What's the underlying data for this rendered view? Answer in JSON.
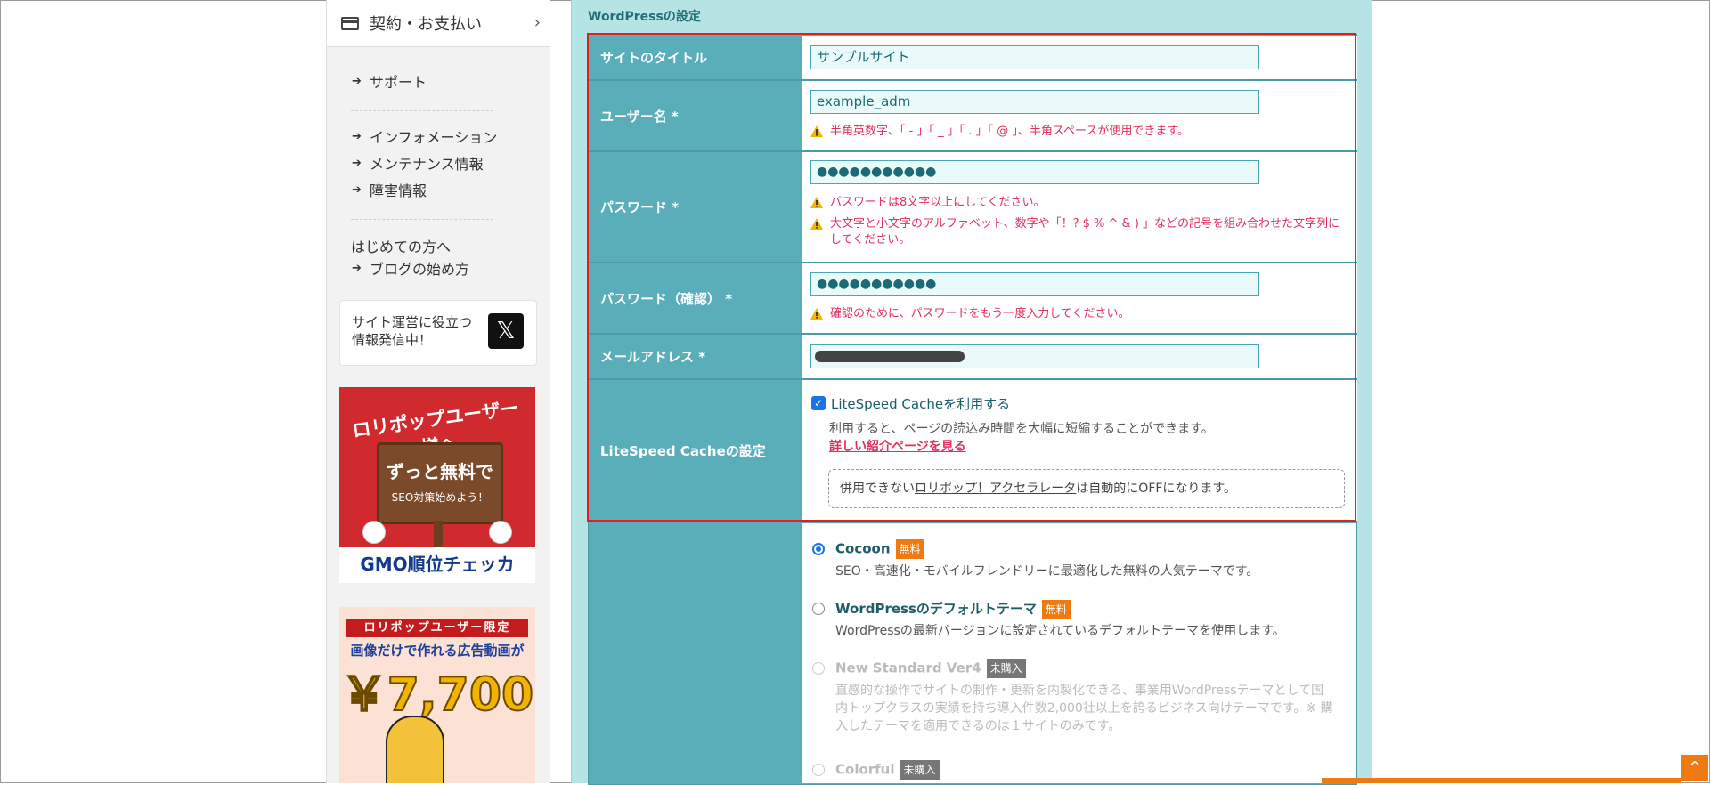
{
  "sidebar": {
    "contract": {
      "label": "契約・お支払い",
      "chevron": "›"
    },
    "support": "サポート",
    "info_links": [
      "インフォメーション",
      "メンテナンス情報",
      "障害情報"
    ],
    "beginner_heading": "はじめての方へ",
    "blog_link": "ブログの始め方",
    "x_box": {
      "line1": "サイト運営に役立つ",
      "line2": "情報発信中！",
      "logo": "𝕏"
    },
    "banner1": {
      "title": "ロリポップユーザー様へ",
      "sign_main": "ずっと無料で",
      "sign_sub": "SEO対策始めよう！",
      "brand": "GMO順位チェッカー"
    },
    "banner2": {
      "tag": "ロリポップユーザー限定",
      "line": "画像だけで作れる広告動画が",
      "price": "￥7,700"
    }
  },
  "main": {
    "section_title": "WordPressの設定",
    "site_title": {
      "label": "サイトのタイトル",
      "value": "サンプルサイト"
    },
    "username": {
      "label": "ユーザー名 *",
      "value": "example_adm",
      "warning": "半角英数字、「 - 」「 _ 」「 . 」「 @ 」、半角スペースが使用できます。"
    },
    "password": {
      "label": "パスワード *",
      "value": "●●●●●●●●●●●",
      "warning1": "パスワードは8文字以上にしてください。",
      "warning2": "大文字と小文字のアルファベット、数字や「！? $ % ^ & ) 」などの記号を組み合わせた文字列にしてください。"
    },
    "password_confirm": {
      "label": "パスワード（確認） *",
      "value": "●●●●●●●●●●●",
      "warning": "確認のために、パスワードをもう一度入力してください。"
    },
    "email": {
      "label": "メールアドレス *"
    },
    "litespeed": {
      "label": "LiteSpeed Cacheの設定",
      "checkbox_label": "LiteSpeed Cacheを利用する",
      "checked": true,
      "description": "利用すると、ページの読込み時間を大幅に短縮することができます。",
      "link": "詳しい紹介ページを見る",
      "note_prefix": "併用できない",
      "note_link": "ロリポップ！アクセラレータ",
      "note_suffix": "は自動的にOFFになります。"
    },
    "themes": [
      {
        "name": "Cocoon",
        "badge": "無料",
        "selected": true,
        "disabled": false,
        "description": "SEO・高速化・モバイルフレンドリーに最適化した無料の人気テーマです。"
      },
      {
        "name": "WordPressのデフォルトテーマ",
        "badge": "無料",
        "selected": false,
        "disabled": false,
        "description": "WordPressの最新バージョンに設定されているデフォルトテーマを使用します。"
      },
      {
        "name": "New Standard Ver4",
        "badge": "未購入",
        "selected": false,
        "disabled": true,
        "description": "直感的な操作でサイトの制作・更新を内製化できる、事業用WordPressテーマとして国内トップクラスの実績を持ち導入件数2,000社以上を誇るビジネス向けテーマです。※ 購入したテーマを適用できるのは１サイトのみです。"
      },
      {
        "name": "Colorful",
        "badge": "未購入",
        "selected": false,
        "disabled": true,
        "description": ""
      }
    ]
  },
  "scroll_top_icon": "^"
}
